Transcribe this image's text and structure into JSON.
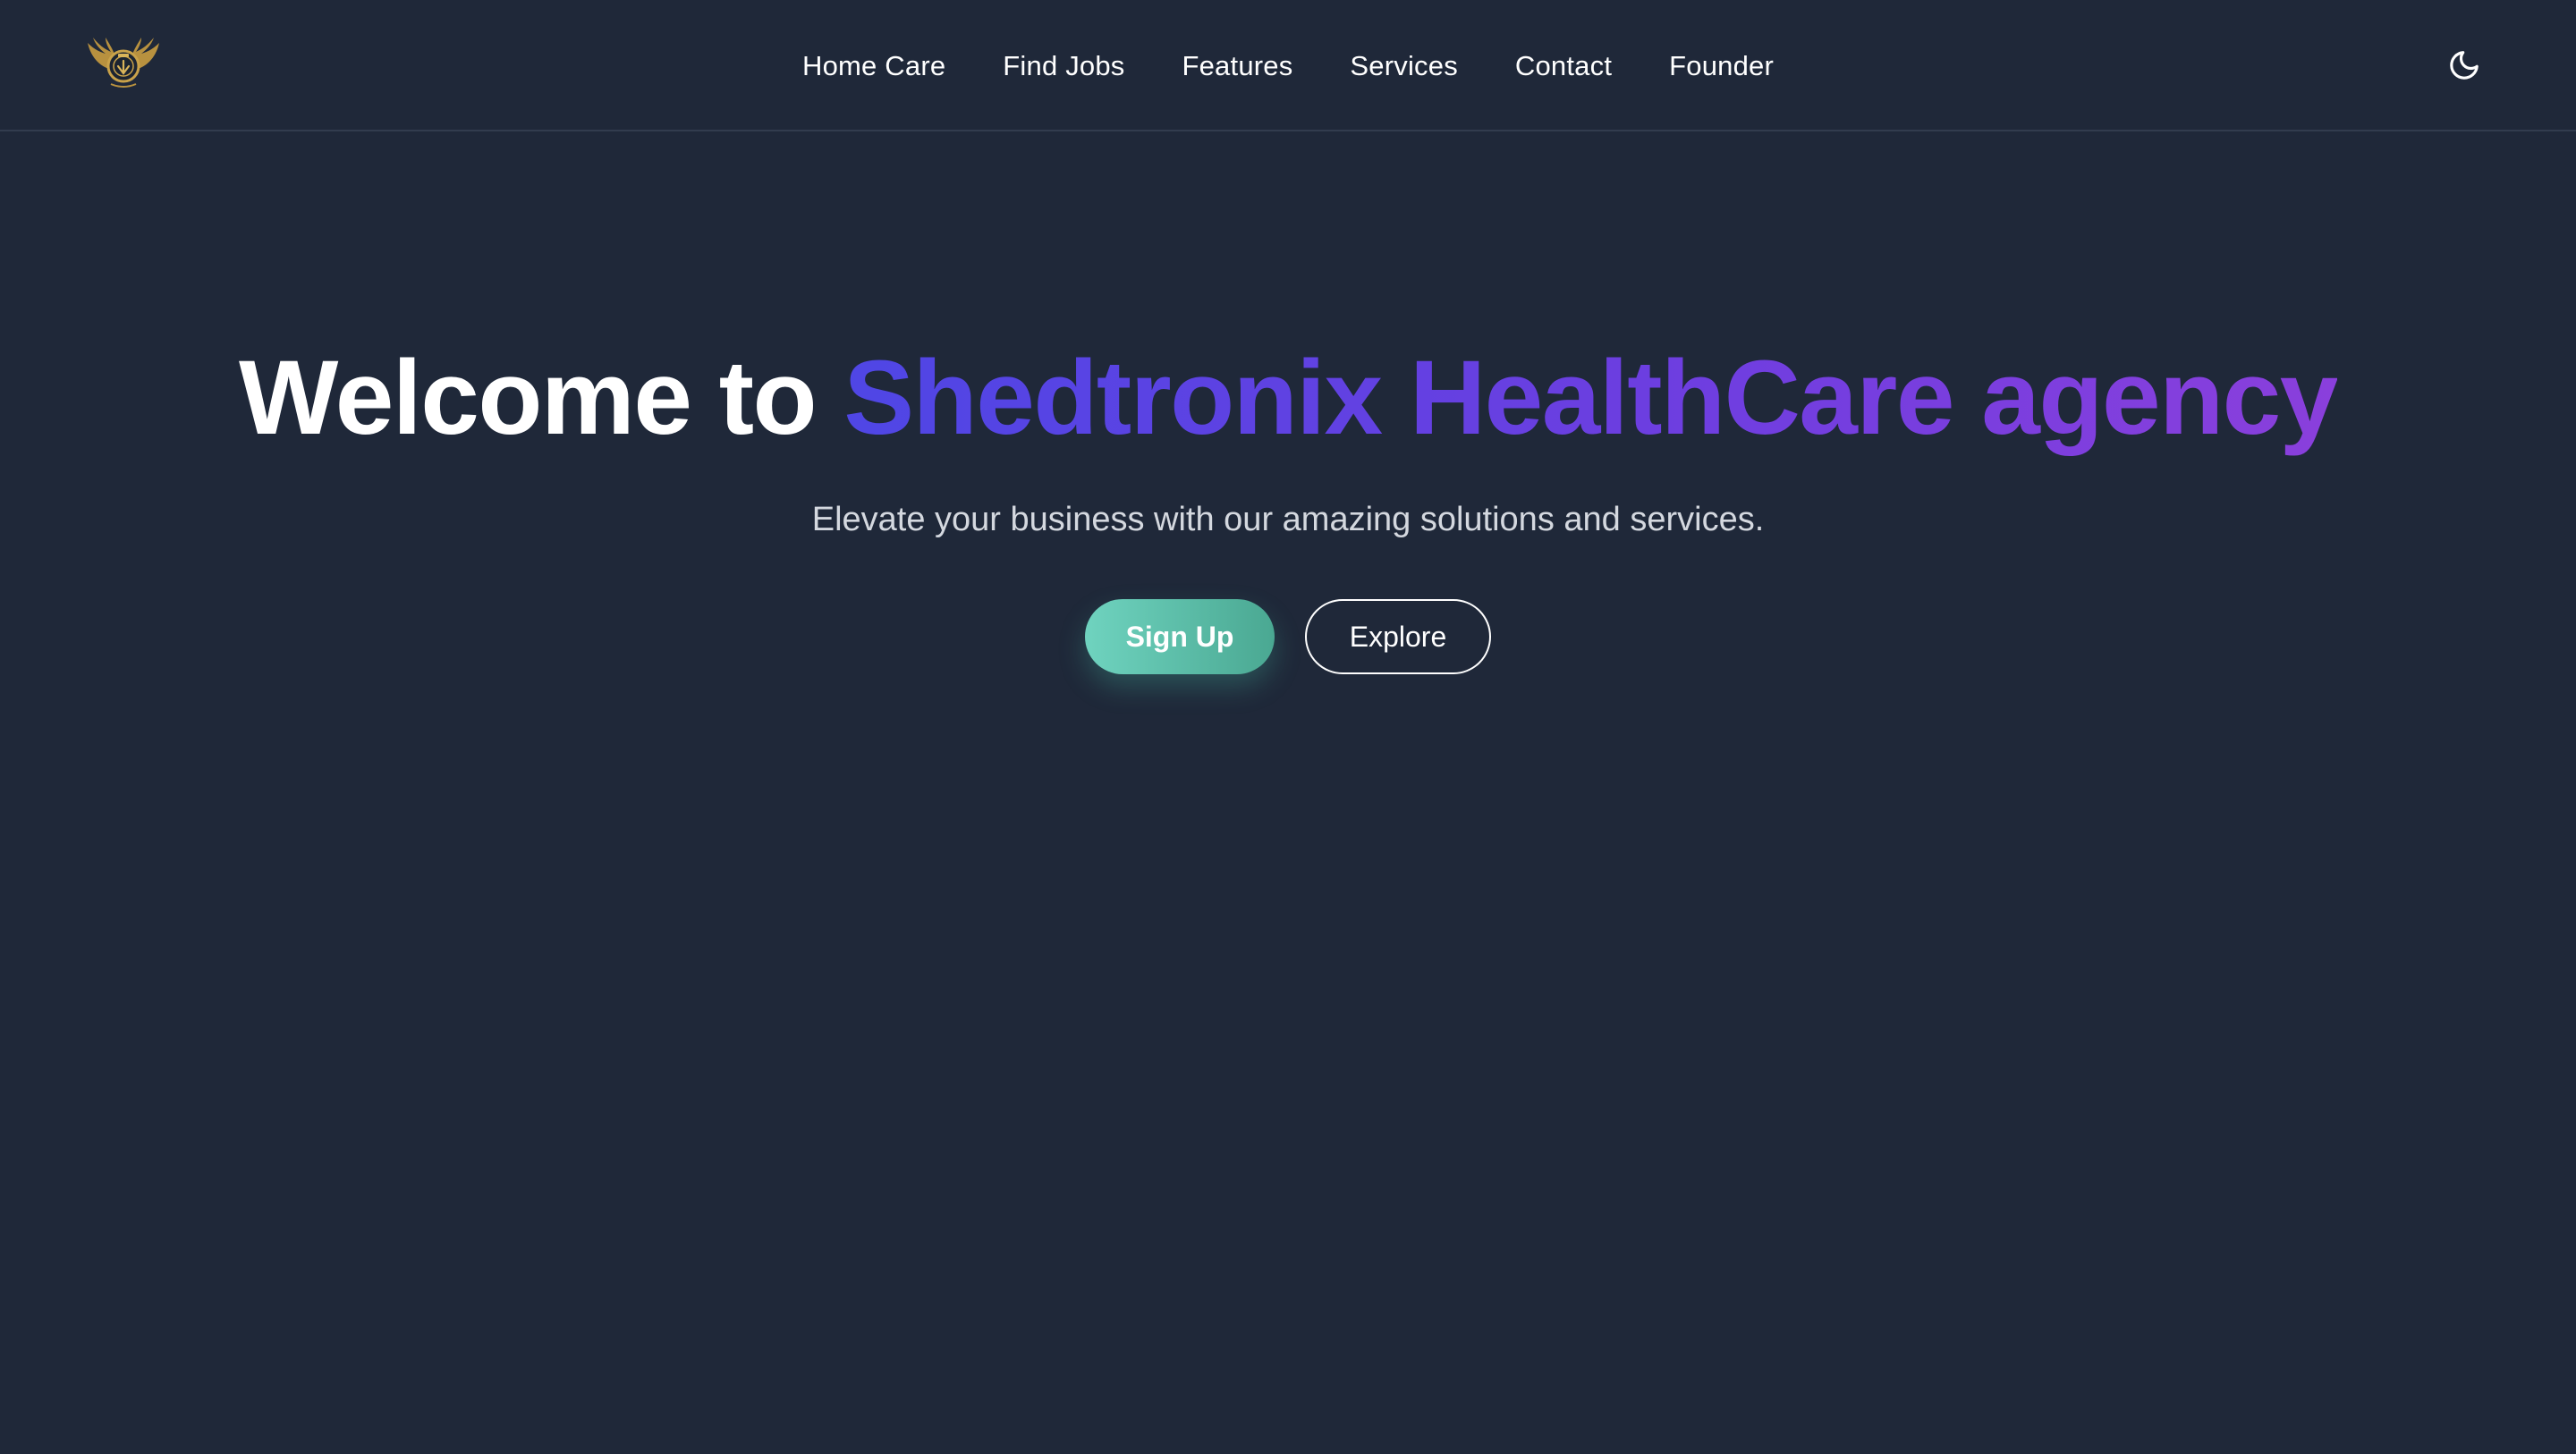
{
  "nav": {
    "logo": "company-logo-emblem",
    "links": [
      "Home Care",
      "Find Jobs",
      "Features",
      "Services",
      "Contact",
      "Founder"
    ],
    "theme_toggle_icon": "moon-icon"
  },
  "hero": {
    "title_prefix": "Welcome to",
    "title_brand": "Shedtronix HealthCare agency",
    "subtitle": "Elevate your business with our amazing solutions and services.",
    "primary_button": "Sign Up",
    "secondary_button": "Explore"
  },
  "colors": {
    "background": "#1f2839",
    "brand_gradient_start": "#4f46e5",
    "brand_gradient_end": "#8a3fdc",
    "signup_gradient_start": "#6fd3bf",
    "signup_gradient_end": "#4aa892"
  }
}
